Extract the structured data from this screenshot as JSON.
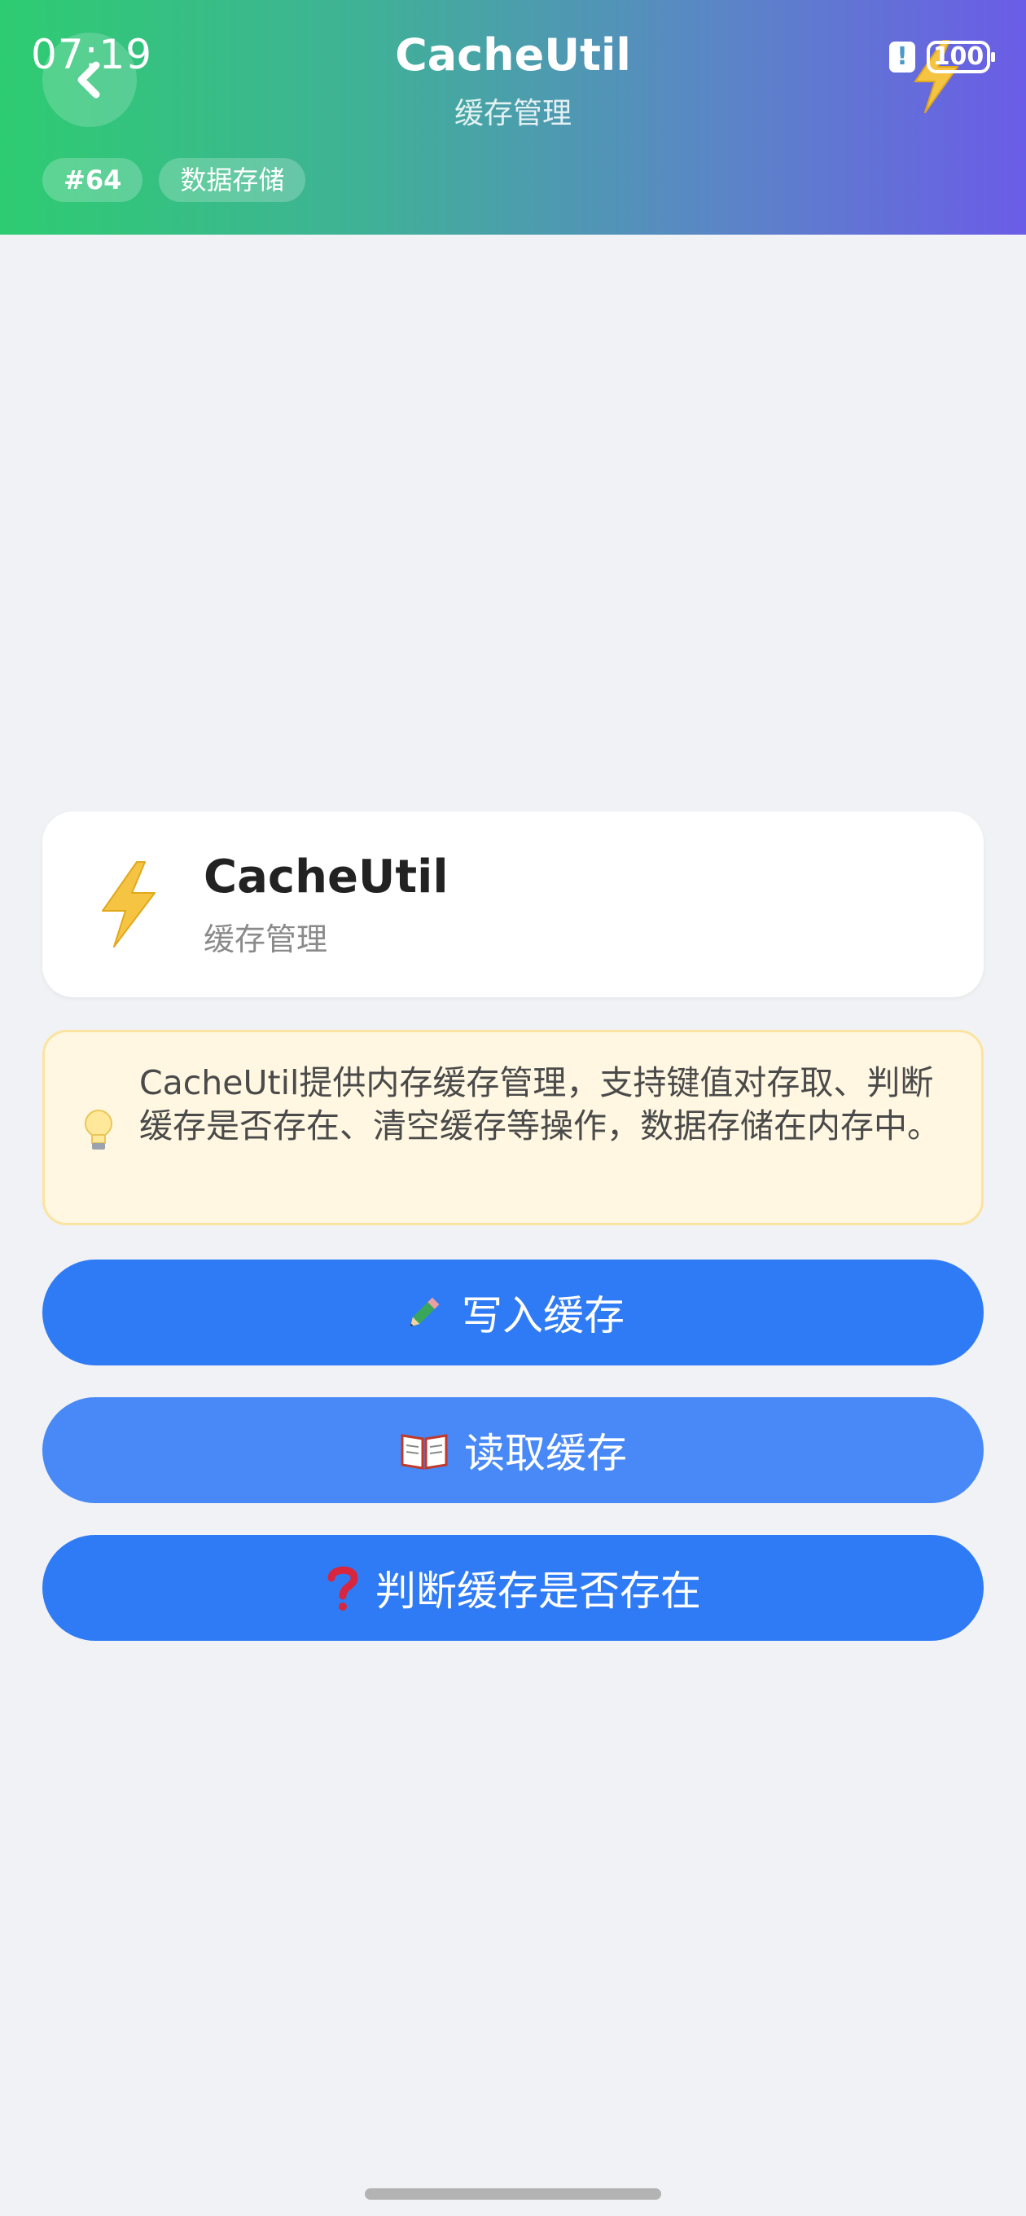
{
  "status_bar": {
    "time": "07:19",
    "alert_symbol": "!",
    "battery_level": "100"
  },
  "header": {
    "title": "CacheUtil",
    "subtitle": "缓存管理",
    "back_icon": "chevron-left-icon",
    "decoration_icon": "lightning-icon",
    "tags": [
      "#64",
      "数据存储"
    ]
  },
  "info_card": {
    "icon": "lightning-icon",
    "title": "CacheUtil",
    "subtitle": "缓存管理"
  },
  "tip": {
    "icon": "lightbulb-icon",
    "text": "CacheUtil提供内存缓存管理，支持键值对存取、判断缓存是否存在、清空缓存等操作，数据存储在内存中。"
  },
  "buttons": [
    {
      "label": "写入缓存",
      "icon": "pencil-icon"
    },
    {
      "label": "读取缓存",
      "icon": "open-book-icon"
    },
    {
      "label": "判断缓存是否存在",
      "icon": "question-mark-icon"
    }
  ],
  "colors": {
    "header_gradient_start": "#2ecc71",
    "header_gradient_end": "#6b5ce7",
    "button_primary": "#2f7bf5",
    "button_secondary": "#4889f7",
    "tip_background": "#fff7e1",
    "page_background": "#f0f2f5"
  }
}
